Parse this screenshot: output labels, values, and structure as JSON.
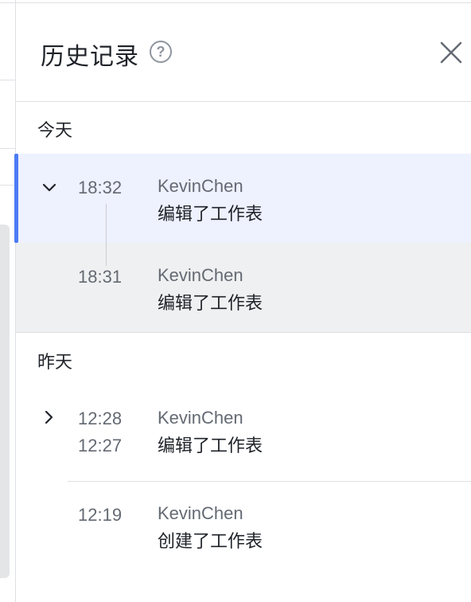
{
  "panel": {
    "title": "历史记录",
    "help_icon": "question-circle-icon",
    "close_icon": "close-icon"
  },
  "groups": [
    {
      "label": "今天",
      "entries": [
        {
          "time": "18:32",
          "user": "KevinChen",
          "action": "编辑了工作表",
          "expanded": true
        },
        {
          "time": "18:31",
          "user": "KevinChen",
          "action": "编辑了工作表"
        }
      ]
    },
    {
      "label": "昨天",
      "entries": [
        {
          "time_start": "12:28",
          "time_end": "12:27",
          "user": "KevinChen",
          "action": "编辑了工作表",
          "expanded": false
        },
        {
          "time": "12:19",
          "user": "KevinChen",
          "action": "创建了工作表"
        }
      ]
    }
  ],
  "colors": {
    "accent": "#4c7bf5",
    "active_bg": "#eef1fe",
    "sub_bg": "#eff0f1",
    "muted_text": "#646a73",
    "border": "#dee0e3"
  }
}
